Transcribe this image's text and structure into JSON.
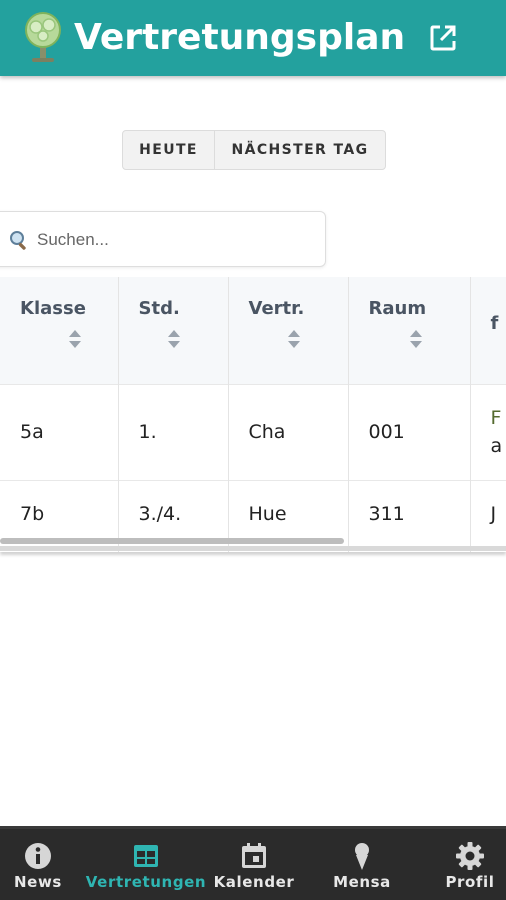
{
  "header": {
    "title": "Vertretungsplan",
    "logo_icon": "tree-logo-icon",
    "action_icon": "open-external-icon",
    "color": "#23a19e"
  },
  "day_toggle": {
    "today_label": "HEUTE",
    "next_label": "NÄCHSTER TAG"
  },
  "search": {
    "placeholder": "Suchen...",
    "value": "",
    "icon": "magnifier-icon"
  },
  "table": {
    "columns": [
      "Klasse",
      "Std.",
      "Vertr.",
      "Raum",
      "f"
    ],
    "rows": [
      [
        "5a",
        "1.",
        "Cha",
        "001",
        "F",
        "a"
      ],
      [
        "7b",
        "3./4.",
        "Hue",
        "311",
        "J"
      ]
    ]
  },
  "bottom_nav": {
    "items": [
      {
        "label": "News",
        "icon": "info-icon"
      },
      {
        "label": "Vertretungen",
        "icon": "grid-table-icon"
      },
      {
        "label": "Kalender",
        "icon": "calendar-icon"
      },
      {
        "label": "Mensa",
        "icon": "ice-cream-icon"
      },
      {
        "label": "Profil",
        "icon": "gear-icon"
      }
    ],
    "active_color": "#2fb5b2"
  }
}
